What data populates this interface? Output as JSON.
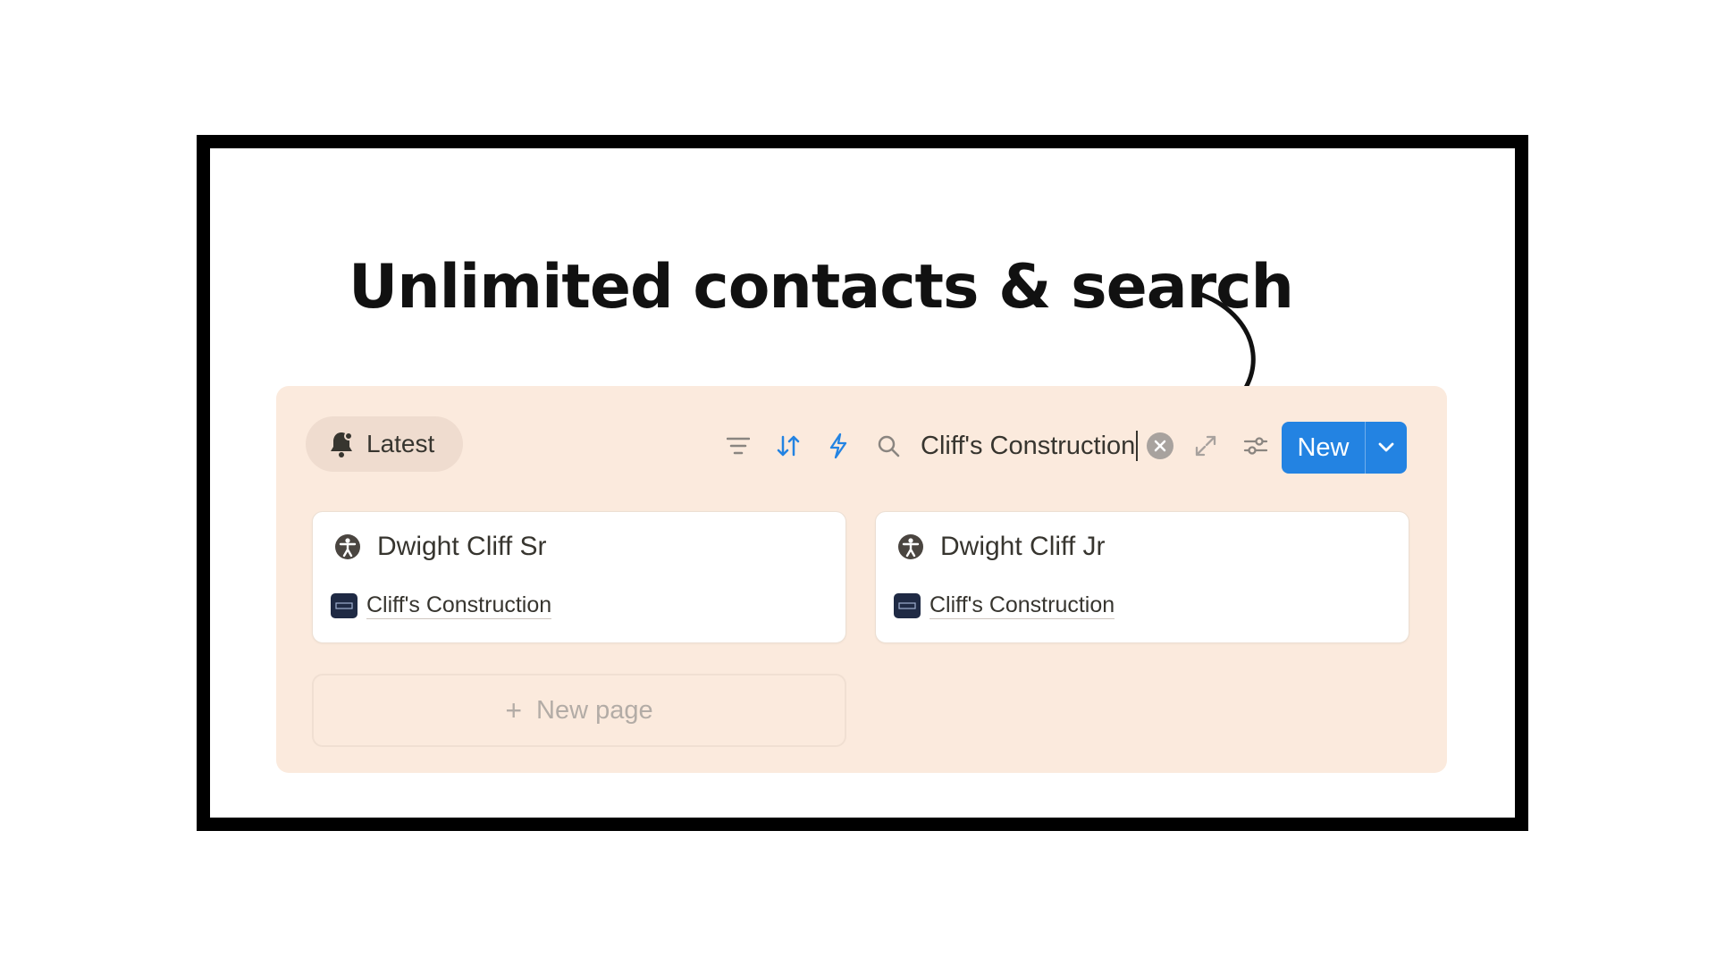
{
  "headline": "Unlimited contacts & search",
  "view": {
    "label": "Latest",
    "icon": "bell-icon"
  },
  "toolbar": {
    "filter_icon": "filter-icon",
    "sort_icon": "sort-icon",
    "automation_icon": "lightning-icon",
    "search_icon": "search-icon",
    "search_value": "Cliff's Construction",
    "clear_icon": "clear-circle-icon",
    "expand_icon": "expand-icon",
    "settings_icon": "settings-sliders-icon",
    "new_label": "New",
    "new_dropdown_icon": "chevron-down-icon"
  },
  "cards": [
    {
      "name": "Dwight Cliff Sr",
      "company": "Cliff's Construction",
      "icon": "person-icon"
    },
    {
      "name": "Dwight Cliff Jr",
      "company": "Cliff's Construction",
      "icon": "person-icon"
    }
  ],
  "new_page_label": "New page",
  "colors": {
    "panel_bg": "#fbeadd",
    "accent_blue": "#2383e2",
    "text_primary": "#37352f",
    "frame_border": "#000000"
  }
}
